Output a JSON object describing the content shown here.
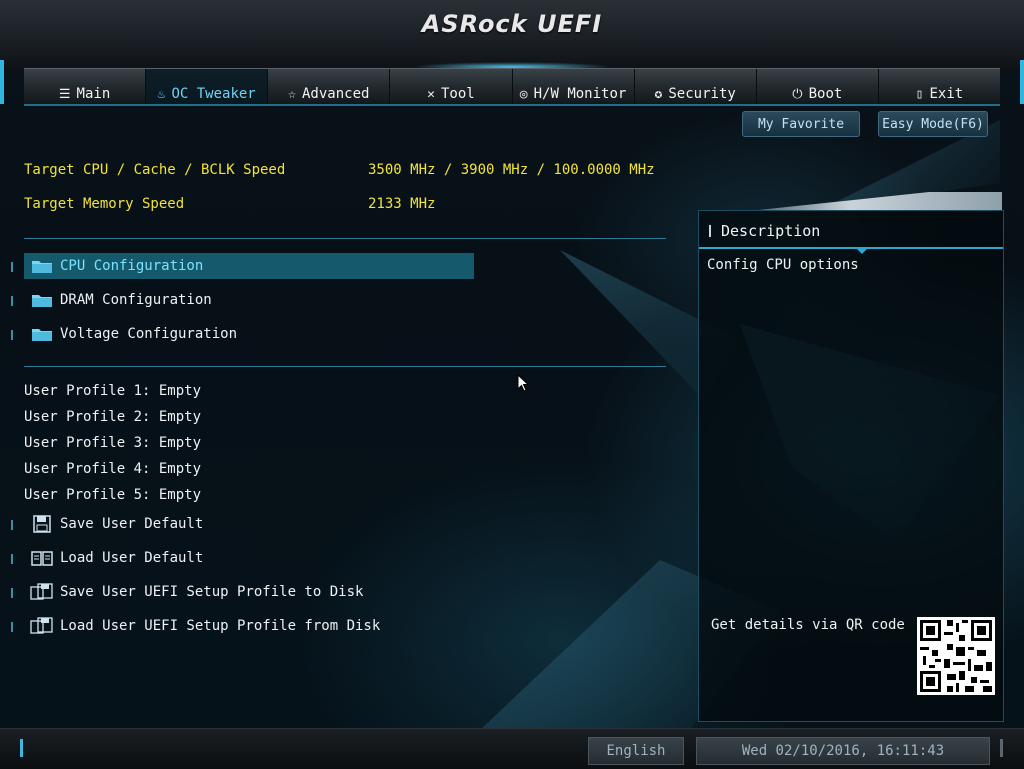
{
  "header": {
    "logo": "ASRock UEFI"
  },
  "tabs": [
    {
      "label": "Main",
      "icon": "list-icon",
      "active": false
    },
    {
      "label": "OC Tweaker",
      "icon": "flame-icon",
      "active": true
    },
    {
      "label": "Advanced",
      "icon": "star-icon",
      "active": false
    },
    {
      "label": "Tool",
      "icon": "tools-icon",
      "active": false
    },
    {
      "label": "H/W Monitor",
      "icon": "monitor-icon",
      "active": false
    },
    {
      "label": "Security",
      "icon": "shield-icon",
      "active": false
    },
    {
      "label": "Boot",
      "icon": "power-icon",
      "active": false
    },
    {
      "label": "Exit",
      "icon": "exit-icon",
      "active": false
    }
  ],
  "toolbar": {
    "favorite_label": "My Favorite",
    "easy_mode_label": "Easy Mode(F6)"
  },
  "info": {
    "cpu_label": "Target CPU / Cache / BCLK Speed",
    "cpu_value": "3500 MHz / 3900 MHz / 100.0000 MHz",
    "mem_label": "Target Memory Speed",
    "mem_value": "2133 MHz"
  },
  "menu": [
    {
      "label": "CPU Configuration",
      "icon": "folder-icon",
      "selected": true
    },
    {
      "label": "DRAM Configuration",
      "icon": "folder-icon",
      "selected": false
    },
    {
      "label": "Voltage Configuration",
      "icon": "folder-icon",
      "selected": false
    }
  ],
  "profiles": [
    "User Profile 1: Empty",
    "User Profile 2: Empty",
    "User Profile 3: Empty",
    "User Profile 4: Empty",
    "User Profile 5: Empty"
  ],
  "actions": [
    {
      "label": "Save User Default",
      "icon": "floppy-icon"
    },
    {
      "label": "Load User Default",
      "icon": "book-icon"
    },
    {
      "label": "Save User UEFI Setup Profile to Disk",
      "icon": "disk-save-icon"
    },
    {
      "label": "Load User UEFI Setup Profile from Disk",
      "icon": "disk-load-icon"
    }
  ],
  "description": {
    "title": "Description",
    "text": "Config CPU options",
    "qr_label": "Get details via QR code"
  },
  "footer": {
    "language": "English",
    "datetime": "Wed 02/10/2016, 16:11:43"
  },
  "colors": {
    "accent": "#2aa8d4",
    "highlight": "#155a6c",
    "info_text": "#f2e33a"
  }
}
